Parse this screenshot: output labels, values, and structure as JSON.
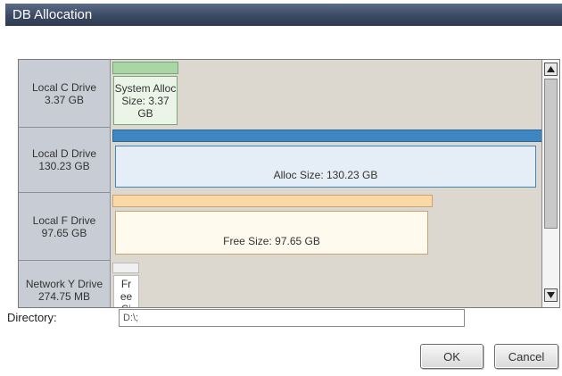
{
  "window": {
    "title": "DB Allocation"
  },
  "drives": [
    {
      "name": "Local C Drive",
      "size": "3.37 GB",
      "box_label": "System Alloc Size: 3.37 GB"
    },
    {
      "name": "Local D Drive",
      "size": "130.23 GB",
      "box_label": "Alloc Size: 130.23 GB"
    },
    {
      "name": "Local F Drive",
      "size": "97.65 GB",
      "box_label": "Free Size: 97.65 GB"
    },
    {
      "name": "Network Y Drive",
      "size": "274.75 MB",
      "box_label": "Fr ee Si"
    }
  ],
  "directory": {
    "label": "Directory:",
    "value": "D:\\;"
  },
  "buttons": {
    "ok": "OK",
    "cancel": "Cancel"
  },
  "colors": {
    "titlebar": "#3b4a63",
    "c_bar": "#a9d6a4",
    "d_bar": "#3e86c1",
    "f_bar": "#fbd9a6",
    "list_bg": "#ddd8cf",
    "label_bg": "#c8ccd5"
  }
}
